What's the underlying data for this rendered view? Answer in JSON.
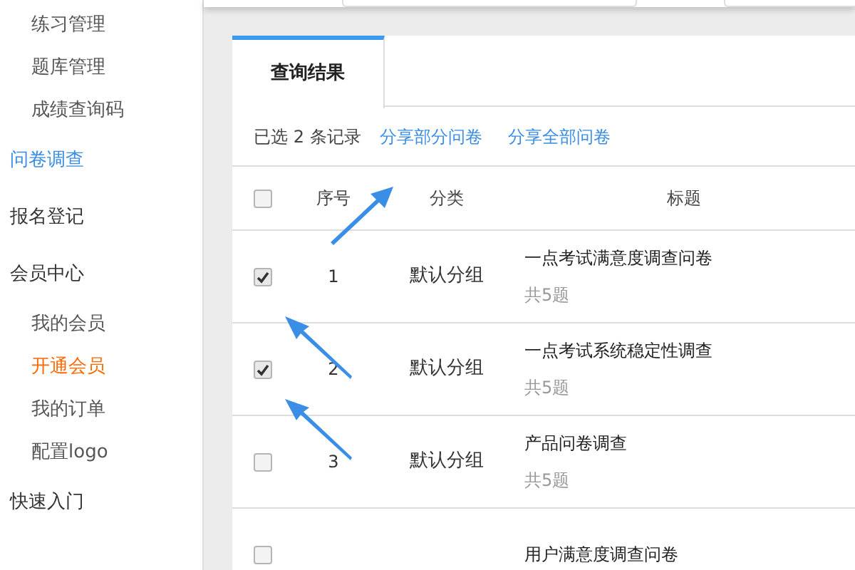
{
  "sidebar": {
    "items": [
      {
        "label": "练习管理",
        "kind": "sub",
        "selected": false
      },
      {
        "label": "题库管理",
        "kind": "sub",
        "selected": false
      },
      {
        "label": "成绩查询码",
        "kind": "sub",
        "selected": false
      },
      {
        "label": "问卷调查",
        "kind": "top",
        "selected": true
      },
      {
        "label": "报名登记",
        "kind": "top",
        "selected": false
      },
      {
        "label": "会员中心",
        "kind": "top",
        "selected": false
      },
      {
        "label": "我的会员",
        "kind": "sub",
        "selected": false
      },
      {
        "label": "开通会员",
        "kind": "sub",
        "selected": true
      },
      {
        "label": "我的订单",
        "kind": "sub",
        "selected": false
      },
      {
        "label": "配置logo",
        "kind": "sub",
        "selected": false
      },
      {
        "label": "快速入门",
        "kind": "top",
        "selected": false
      }
    ]
  },
  "tabs": [
    {
      "label": "查询结果",
      "selected": true
    }
  ],
  "toolbar": {
    "selection_text": "已选 2 条记录",
    "links": [
      "分享部分问卷",
      "分享全部问卷"
    ]
  },
  "table": {
    "select_all_checked": false,
    "columns": [
      "序号",
      "分类",
      "标题"
    ],
    "rows": [
      {
        "checked": true,
        "number": "1",
        "category": "默认分组",
        "title": "一点考试满意度调查问卷",
        "count": "共5题"
      },
      {
        "checked": true,
        "number": "2",
        "category": "默认分组",
        "title": "一点考试系统稳定性调查",
        "count": "共5题"
      },
      {
        "checked": false,
        "number": "3",
        "category": "默认分组",
        "title": "产品问卷调查",
        "count": "共5题"
      },
      {
        "checked": false,
        "title": "用户满意度调查问卷"
      }
    ]
  }
}
